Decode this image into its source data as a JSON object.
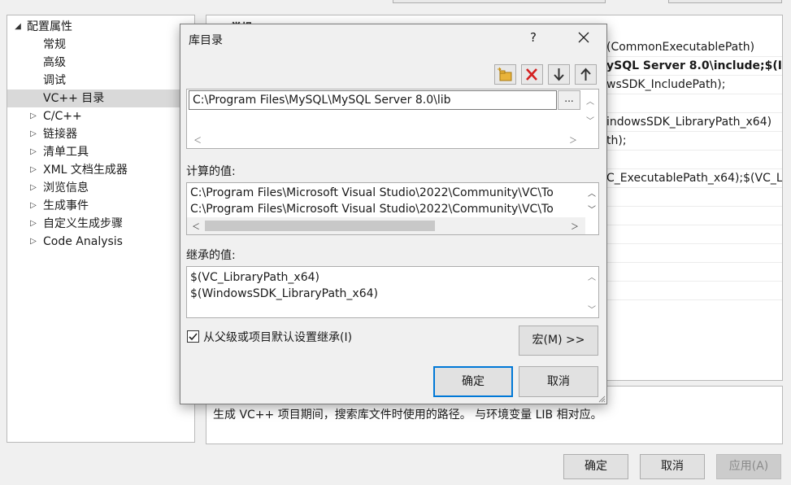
{
  "tree": {
    "root_label": "配置属性",
    "items": [
      {
        "label": "常规",
        "expandable": false,
        "selected": false
      },
      {
        "label": "高级",
        "expandable": false,
        "selected": false
      },
      {
        "label": "调试",
        "expandable": false,
        "selected": false
      },
      {
        "label": "VC++ 目录",
        "expandable": false,
        "selected": true
      },
      {
        "label": "C/C++",
        "expandable": true,
        "selected": false
      },
      {
        "label": "链接器",
        "expandable": true,
        "selected": false
      },
      {
        "label": "清单工具",
        "expandable": true,
        "selected": false
      },
      {
        "label": "XML 文档生成器",
        "expandable": true,
        "selected": false
      },
      {
        "label": "浏览信息",
        "expandable": true,
        "selected": false
      },
      {
        "label": "生成事件",
        "expandable": true,
        "selected": false
      },
      {
        "label": "自定义生成步骤",
        "expandable": true,
        "selected": false
      },
      {
        "label": "Code Analysis",
        "expandable": true,
        "selected": false
      }
    ]
  },
  "props": {
    "header": "常规",
    "values": [
      {
        "text": "(CommonExecutablePath)",
        "bold": false
      },
      {
        "text": "ySQL Server 8.0\\include;$(In",
        "bold": true
      },
      {
        "text": "wsSDK_IncludePath);",
        "bold": false
      },
      {
        "text": "",
        "bold": false
      },
      {
        "text": "indowsSDK_LibraryPath_x64)",
        "bold": false
      },
      {
        "text": "th);",
        "bold": false
      },
      {
        "text": "",
        "bold": false
      },
      {
        "text": "C_ExecutablePath_x64);$(VC_L",
        "bold": false
      }
    ],
    "description": "生成 VC++ 项目期间，搜索库文件时使用的路径。 与环境变量 LIB 相对应。"
  },
  "bottom_buttons": {
    "ok": "确定",
    "cancel": "取消",
    "apply": "应用(A)"
  },
  "dialog": {
    "title": "库目录",
    "help": "?",
    "edit_value": "C:\\Program Files\\MySQL\\MySQL Server 8.0\\lib",
    "browse_label": "...",
    "computed_label": "计算的值:",
    "computed_values": [
      "C:\\Program Files\\Microsoft Visual Studio\\2022\\Community\\VC\\To",
      "C:\\Program Files\\Microsoft Visual Studio\\2022\\Community\\VC\\To"
    ],
    "inherited_label": "继承的值:",
    "inherited_values": [
      "$(VC_LibraryPath_x64)",
      "$(WindowsSDK_LibraryPath_x64)"
    ],
    "inherit_checkbox_label": "从父级或项目默认设置继承(I)",
    "inherit_checked": true,
    "macro_button": "宏(M) >>",
    "ok": "确定",
    "cancel": "取消"
  },
  "colors": {
    "accent": "#0078d7",
    "delete_red": "#d42020",
    "folder_yellow": "#e8b33a"
  }
}
